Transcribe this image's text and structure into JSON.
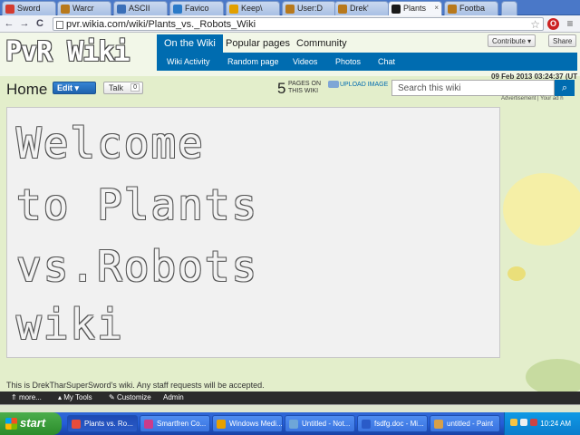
{
  "browser": {
    "tabs": [
      {
        "label": "Sword",
        "color": "#d43b2f"
      },
      {
        "label": "Warcr",
        "color": "#b8791c"
      },
      {
        "label": "ASCII",
        "color": "#3a6fb8"
      },
      {
        "label": "Favico",
        "color": "#2a7ac8"
      },
      {
        "label": "Keep\\",
        "color": "#e2a000"
      },
      {
        "label": "User:D",
        "color": "#b8791c"
      },
      {
        "label": "Drek'",
        "color": "#b8791c"
      },
      {
        "label": "Plants",
        "color": "#1a1a1a"
      },
      {
        "label": "Footba",
        "color": "#b8791c"
      }
    ],
    "tab_close": "×",
    "url": "pvr.wikia.com/wiki/Plants_vs._Robots_Wiki",
    "back": "←",
    "forward": "→",
    "reload": "C",
    "star": "☆"
  },
  "wiki": {
    "logo": "PvR Wiki",
    "nav_tabs": [
      "On the Wiki",
      "Popular pages",
      "Community"
    ],
    "sub_nav": [
      "Wiki Activity",
      "Random page",
      "Videos",
      "Photos",
      "Chat"
    ],
    "contribute": "Contribute ▾",
    "share": "Share",
    "timestamp": "09 Feb 2013 03:24:37 (UT",
    "page_title": "Home",
    "edit_label": "Edit ▾",
    "talk_label": "Talk",
    "talk_count": "0",
    "page_count": "5",
    "page_count_label_1": "PAGES ON",
    "page_count_label_2": "THIS WIKI",
    "upload_label": "UPLOAD IMAGE",
    "search_placeholder": "Search this wiki",
    "ad_label": "Advertisement | Your ad h",
    "ascii_lines": [
      "Welcome",
      "to Plants",
      "vs.Robots",
      "wiki"
    ],
    "footer_text": "This is DrekTharSuperSword's wiki. Any staff requests will be accepted."
  },
  "toolbar": {
    "more": "more...",
    "my_tools": "My Tools",
    "customize": "Customize",
    "admin": "Admin"
  },
  "taskbar": {
    "start": "start",
    "tasks": [
      {
        "label": "Plants vs. Ro...",
        "color": "#e74c3c"
      },
      {
        "label": "Smartfren Co...",
        "color": "#cc3c8a"
      },
      {
        "label": "Windows Medi...",
        "color": "#e8a000"
      },
      {
        "label": "Untitled - Not...",
        "color": "#6ea6d8"
      },
      {
        "label": "fsdfg.doc - Mi...",
        "color": "#2a5bc8"
      },
      {
        "label": "untitled - Paint",
        "color": "#d8a048"
      }
    ],
    "clock": "10:24 AM"
  }
}
